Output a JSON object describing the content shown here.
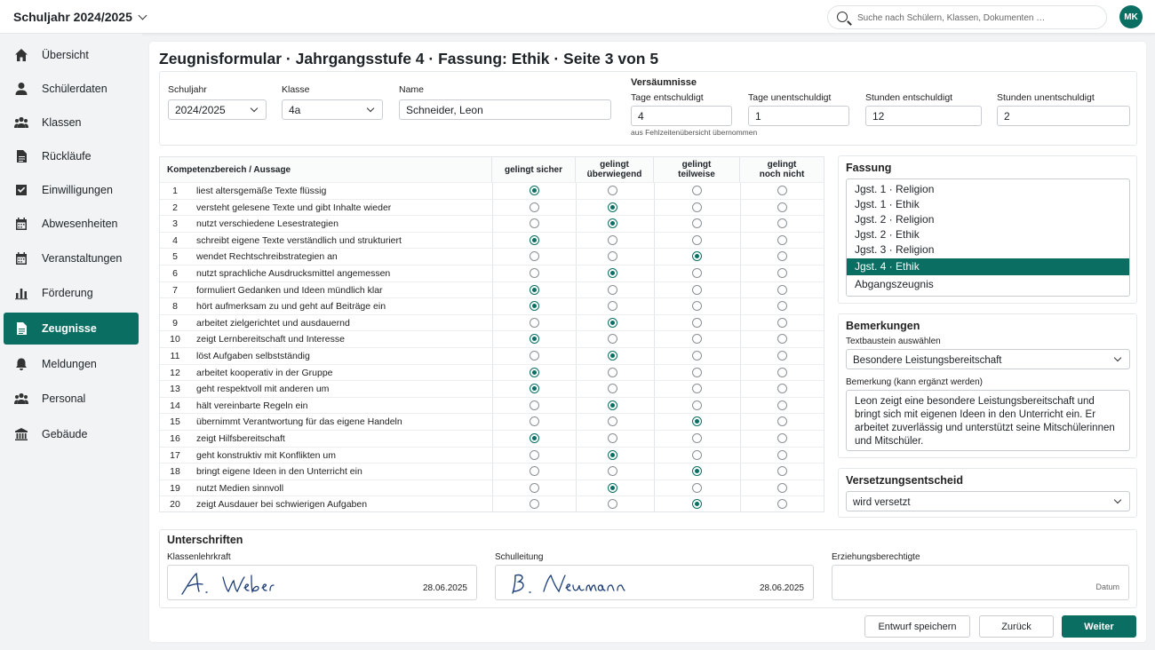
{
  "header": {
    "school_year_label": "Schuljahr 2024/2025",
    "search_placeholder": "Suche nach Schülern, Klassen, Dokumenten …",
    "avatar_initials": "MK"
  },
  "sidebar": {
    "items": [
      {
        "label": "Übersicht",
        "icon": "home-icon"
      },
      {
        "label": "Schülerdaten",
        "icon": "person-icon"
      },
      {
        "label": "Klassen",
        "icon": "group-icon"
      },
      {
        "label": "Rückläufe",
        "icon": "document-icon"
      },
      {
        "label": "Einwilligungen",
        "icon": "checkbox-icon"
      },
      {
        "label": "Abwesenheiten",
        "icon": "calendar-icon"
      },
      {
        "label": "Veranstaltungen",
        "icon": "calendar-icon"
      },
      {
        "label": "Förderung",
        "icon": "bar-chart-icon"
      },
      {
        "label": "Zeugnisse",
        "icon": "document-icon",
        "active": true
      },
      {
        "label": "Meldungen",
        "icon": "bell-icon"
      },
      {
        "label": "Personal",
        "icon": "group-icon"
      },
      {
        "label": "Gebäude",
        "icon": "building-icon"
      }
    ]
  },
  "page": {
    "title": "Zeugnisformular · Jahrgangsstufe 4 · Fassung: Ethik · Seite 3 von 5"
  },
  "form": {
    "schuljahr_label": "Schuljahr",
    "schuljahr_value": "2024/2025",
    "klasse_label": "Klasse",
    "klasse_value": "4a",
    "name_label": "Name",
    "name_value": "Schneider, Leon"
  },
  "absences": {
    "title": "Versäumnisse",
    "excused_days_label": "Tage entschuldigt",
    "excused_days_value": "4",
    "excused_days_hint": "aus Fehlzeitenübersicht übernommen",
    "unexcused_days_label": "Tage unentschuldigt",
    "unexcused_days_value": "1",
    "excused_hours_label": "Stunden entschuldigt",
    "excused_hours_value": "12",
    "unexcused_hours_label": "Stunden unentschuldigt",
    "unexcused_hours_value": "2"
  },
  "competencies": {
    "columns": [
      "Kompetenzbereich / Aussage",
      "gelingt sicher",
      "gelingt\nüberwiegend",
      "gelingt\nteilweise",
      "gelingt\nnoch nicht"
    ],
    "rows": [
      {
        "num": "1",
        "text": "liest altersgemäße Texte flüssig",
        "rating": 0
      },
      {
        "num": "2",
        "text": "versteht gelesene Texte und gibt Inhalte wieder",
        "rating": 1
      },
      {
        "num": "3",
        "text": "nutzt verschiedene Lesestrategien",
        "rating": 1
      },
      {
        "num": "4",
        "text": "schreibt eigene Texte verständlich und strukturiert",
        "rating": 0
      },
      {
        "num": "5",
        "text": "wendet Rechtschreibstrategien an",
        "rating": 2
      },
      {
        "num": "6",
        "text": "nutzt sprachliche Ausdrucksmittel angemessen",
        "rating": 1
      },
      {
        "num": "7",
        "text": "formuliert Gedanken und Ideen mündlich klar",
        "rating": 0
      },
      {
        "num": "8",
        "text": "hört aufmerksam zu und geht auf Beiträge ein",
        "rating": 0
      },
      {
        "num": "9",
        "text": "arbeitet zielgerichtet und ausdauernd",
        "rating": 1
      },
      {
        "num": "10",
        "text": "zeigt Lernbereitschaft und Interesse",
        "rating": 0
      },
      {
        "num": "11",
        "text": "löst Aufgaben selbstständig",
        "rating": 1
      },
      {
        "num": "12",
        "text": "arbeitet kooperativ in der Gruppe",
        "rating": 0
      },
      {
        "num": "13",
        "text": "geht respektvoll mit anderen um",
        "rating": 0
      },
      {
        "num": "14",
        "text": "hält vereinbarte Regeln ein",
        "rating": 1
      },
      {
        "num": "15",
        "text": "übernimmt Verantwortung für das eigene Handeln",
        "rating": 2
      },
      {
        "num": "16",
        "text": "zeigt Hilfsbereitschaft",
        "rating": 0
      },
      {
        "num": "17",
        "text": "geht konstruktiv mit Konflikten um",
        "rating": 1
      },
      {
        "num": "18",
        "text": "bringt eigene Ideen in den Unterricht ein",
        "rating": 2
      },
      {
        "num": "19",
        "text": "nutzt Medien sinnvoll",
        "rating": 1
      },
      {
        "num": "20",
        "text": "zeigt Ausdauer bei schwierigen Aufgaben",
        "rating": 2
      }
    ]
  },
  "fassung": {
    "title": "Fassung",
    "options": [
      "Jgst. 1 · Religion",
      "Jgst. 1 · Ethik",
      "Jgst. 2 · Religion",
      "Jgst. 2 · Ethik",
      "Jgst. 3 · Religion",
      "Jgst. 4 · Ethik",
      "Abgangszeugnis"
    ],
    "selected_index": 5
  },
  "remarks": {
    "title": "Bemerkungen",
    "template_label": "Textbaustein auswählen",
    "template_value": "Besondere Leistungsbereitschaft",
    "remark_label": "Bemerkung (kann ergänzt werden)",
    "remark_text": "Leon zeigt eine besondere Leistungsbereitschaft und bringt sich mit eigenen Ideen in den Unterricht ein. Er arbeitet zuverlässig und unterstützt seine Mitschülerinnen und Mitschüler."
  },
  "promotion": {
    "title": "Versetzungsentscheid",
    "value": "wird versetzt"
  },
  "signatures": {
    "title": "Unterschriften",
    "teacher_label": "Klassenlehrkraft",
    "teacher_signature": "A. Weber",
    "teacher_date": "28.06.2025",
    "principal_label": "Schulleitung",
    "principal_signature": "B. Neumann",
    "principal_date": "28.06.2025",
    "guardian_label": "Erziehungsberechtigte",
    "guardian_date_placeholder": "Datum"
  },
  "actions": {
    "save_draft": "Entwurf speichern",
    "back": "Zurück",
    "next": "Weiter"
  },
  "colors": {
    "accent": "#0b6e63"
  }
}
